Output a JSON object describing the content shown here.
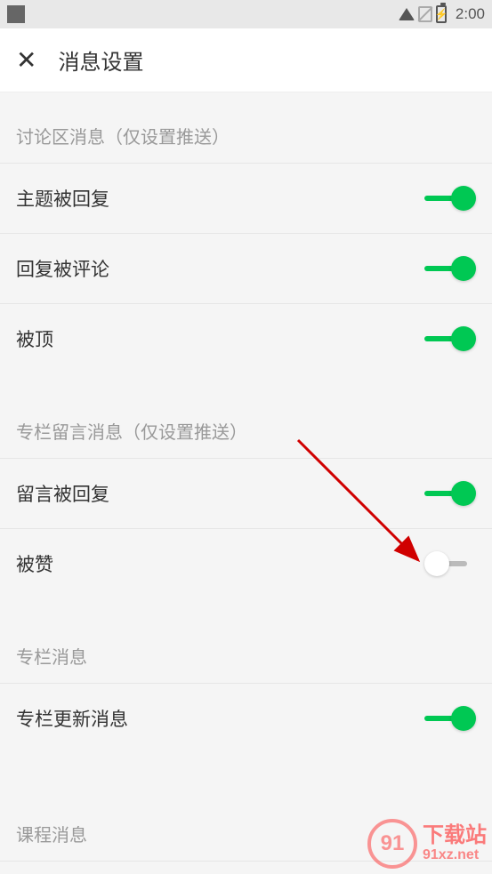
{
  "status": {
    "time": "2:00"
  },
  "header": {
    "title": "消息设置"
  },
  "sections": {
    "discussion": {
      "header": "讨论区消息（仅设置推送）",
      "items": {
        "topic_replied": {
          "label": "主题被回复",
          "on": true
        },
        "reply_commented": {
          "label": "回复被评论",
          "on": true
        },
        "bumped": {
          "label": "被顶",
          "on": true
        }
      }
    },
    "column_comment": {
      "header": "专栏留言消息（仅设置推送）",
      "items": {
        "comment_replied": {
          "label": "留言被回复",
          "on": true
        },
        "liked": {
          "label": "被赞",
          "on": false
        }
      }
    },
    "column": {
      "header": "专栏消息",
      "items": {
        "column_update": {
          "label": "专栏更新消息",
          "on": true
        }
      }
    },
    "course": {
      "header": "课程消息"
    }
  },
  "watermark": {
    "circle": "91",
    "main": "下载站",
    "sub": "91xz.net"
  }
}
